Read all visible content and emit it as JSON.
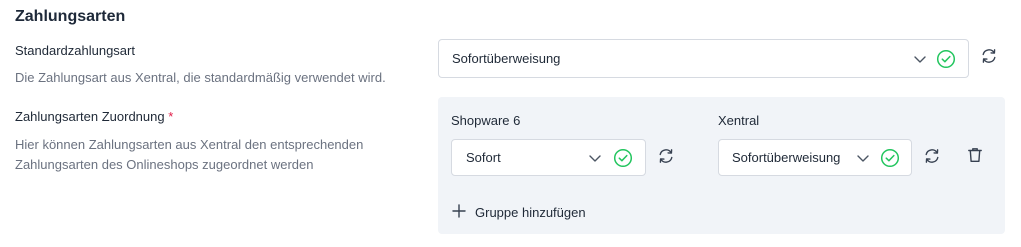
{
  "section": {
    "title": "Zahlungsarten"
  },
  "standard": {
    "label": "Standardzahlungsart",
    "help": "Die Zahlungsart aus Xentral, die standardmäßig verwendet wird.",
    "selected": "Sofortüberweisung"
  },
  "mapping": {
    "label": "Zahlungsarten Zuordnung",
    "required_marker": "*",
    "help_line1": "Hier können Zahlungsarten aus Xentral den entsprechenden",
    "help_line2": "Zahlungsarten des Onlineshops zugeordnet werden",
    "col_shop": "Shopware 6",
    "col_xentral": "Xentral",
    "rows": [
      {
        "shop_value": "Sofort",
        "xentral_value": "Sofortüberweisung"
      }
    ],
    "add_group": "Gruppe hinzufügen"
  },
  "colors": {
    "accent_ok": "#22c55e",
    "panel_bg": "#f1f4f8",
    "required": "#e11d48"
  },
  "icons": {
    "dropdown": "chevron-down-icon",
    "valid": "check-circle-icon",
    "refresh": "refresh-icon",
    "delete": "trash-icon",
    "add": "plus-icon"
  }
}
